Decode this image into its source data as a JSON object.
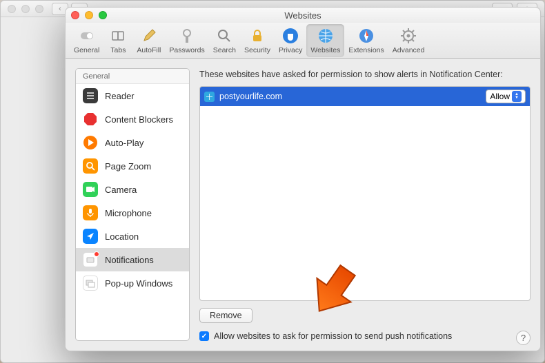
{
  "window": {
    "title": "Websites"
  },
  "toolbar": {
    "items": [
      {
        "label": "General"
      },
      {
        "label": "Tabs"
      },
      {
        "label": "AutoFill"
      },
      {
        "label": "Passwords"
      },
      {
        "label": "Search"
      },
      {
        "label": "Security"
      },
      {
        "label": "Privacy"
      },
      {
        "label": "Websites"
      },
      {
        "label": "Extensions"
      },
      {
        "label": "Advanced"
      }
    ]
  },
  "sidebar": {
    "header": "General",
    "items": [
      {
        "label": "Reader"
      },
      {
        "label": "Content Blockers"
      },
      {
        "label": "Auto-Play"
      },
      {
        "label": "Page Zoom"
      },
      {
        "label": "Camera"
      },
      {
        "label": "Microphone"
      },
      {
        "label": "Location"
      },
      {
        "label": "Notifications"
      },
      {
        "label": "Pop-up Windows"
      }
    ]
  },
  "main": {
    "description": "These websites have asked for permission to show alerts in Notification Center:",
    "websites": [
      {
        "domain": "postyourlife.com",
        "permission": "Allow"
      }
    ],
    "remove_label": "Remove",
    "checkbox_label": "Allow websites to ask for permission to send push notifications",
    "checkbox_checked": true
  },
  "help": "?"
}
